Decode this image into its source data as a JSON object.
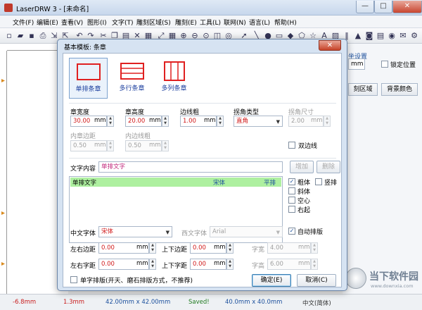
{
  "app": {
    "title": "LaserDRW 3 - [未命名]",
    "controls": [
      "—",
      "□",
      "✕"
    ]
  },
  "menu": [
    "文件(F)",
    "编辑(E)",
    "查看(V)",
    "图形(I)",
    "文字(T)",
    "雕刻区域(S)",
    "雕刻(E)",
    "工具(L)",
    "联网(N)",
    "语言(L)",
    "帮助(H)"
  ],
  "right_panel": {
    "heading": "坐设置",
    "unit": "mm",
    "lock_label": "锁定位置",
    "region_button": "刻区域",
    "bg_color_button": "背景颜色"
  },
  "dialog": {
    "title": "基本模板: 条章",
    "close": "✕",
    "styles": [
      {
        "label": "单排条章",
        "selected": true
      },
      {
        "label": "多行条章",
        "selected": false
      },
      {
        "label": "多列条章",
        "selected": false
      }
    ],
    "width": {
      "label": "章宽度",
      "value": "30.00",
      "unit": "mm"
    },
    "height": {
      "label": "章高度",
      "value": "20.00",
      "unit": "mm"
    },
    "border": {
      "label": "边线粗",
      "value": "1.00",
      "unit": "mm"
    },
    "corner_type": {
      "label": "拐角类型",
      "value": "直角"
    },
    "corner_size": {
      "label": "拐角尺寸",
      "value": "2.00",
      "unit": "mm"
    },
    "inner_margin": {
      "label": "内章边距",
      "value": "0.50",
      "unit": "mm"
    },
    "inner_border": {
      "label": "内边线粗",
      "value": "0.50",
      "unit": "mm"
    },
    "double_border": {
      "label": "双边线",
      "checked": false
    },
    "text_content": {
      "label": "文字内容",
      "value": "单排文字"
    },
    "add_button": "增加",
    "delete_button": "删除",
    "text_list": [
      {
        "text": "单排文字",
        "font": "宋体",
        "mode": "平排"
      }
    ],
    "options": [
      {
        "label": "粗体",
        "checked": true
      },
      {
        "label": "竖排",
        "checked": false
      },
      {
        "label": "斜体",
        "checked": false
      },
      {
        "label": "空心",
        "checked": false
      },
      {
        "label": "右起",
        "checked": false
      }
    ],
    "auto_layout": {
      "label": "自动排版",
      "checked": true
    },
    "cn_font": {
      "label": "中文字体",
      "value": "宋体"
    },
    "en_font": {
      "label": "西文字体",
      "value": "Arial"
    },
    "lr_margin": {
      "label": "左右边距",
      "value": "0.00",
      "unit": "mm"
    },
    "tb_margin": {
      "label": "上下边距",
      "value": "0.00",
      "unit": "mm"
    },
    "char_width": {
      "label": "字宽",
      "value": "4.00",
      "unit": "mm"
    },
    "lr_spacing": {
      "label": "左右字距",
      "value": "0.00",
      "unit": "mm"
    },
    "tb_spacing": {
      "label": "上下字距",
      "value": "0.00",
      "unit": "mm"
    },
    "char_height": {
      "label": "字高",
      "value": "6.00",
      "unit": "mm"
    },
    "single_char": {
      "label": "单字排版(开天、磨石排版方式，不推荐)",
      "checked": false
    },
    "ok_button": "确定(E)",
    "cancel_button": "取消(C)"
  },
  "status": {
    "x": "-6.8mm",
    "y": "1.3mm",
    "size1": "42.00mm x 42.00mm",
    "saved": "Saved!",
    "size2": "40.0mm x 40.0mm",
    "extra": "中文(简体)"
  },
  "watermark": {
    "brand": "当下软件园",
    "site": "www.downxia.com"
  }
}
